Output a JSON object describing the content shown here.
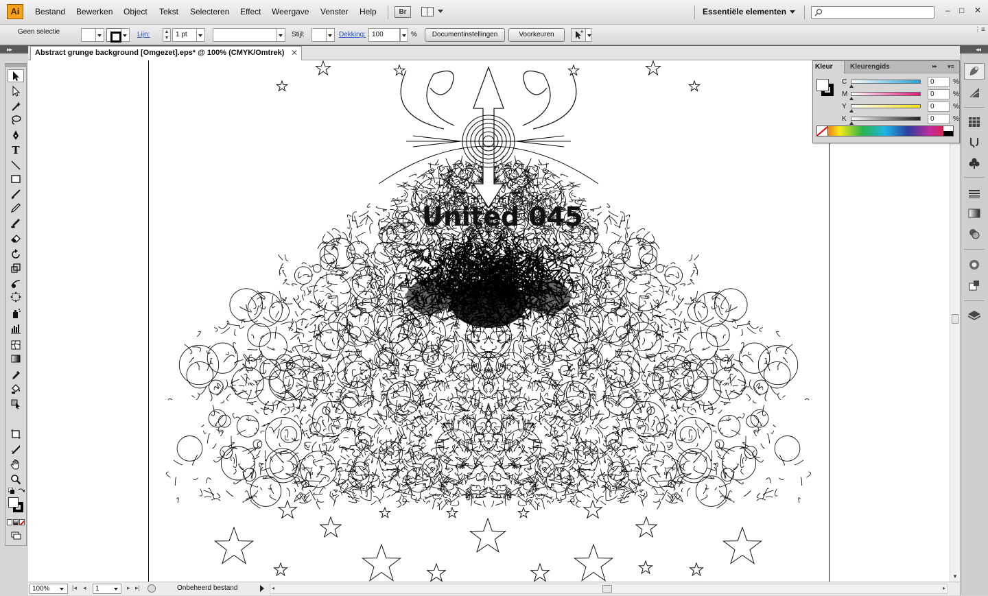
{
  "app": {
    "logo": "Ai",
    "bridge_label": "Br",
    "workspace": "Essentiële elementen"
  },
  "menu": [
    "Bestand",
    "Bewerken",
    "Object",
    "Tekst",
    "Selecteren",
    "Effect",
    "Weergave",
    "Venster",
    "Help"
  ],
  "window_controls": {
    "minimize": "–",
    "restore": "□",
    "close": "✕"
  },
  "controlbar": {
    "selection": "Geen selectie",
    "stroke_label": "Lijn:",
    "stroke_weight": "1 pt",
    "style_label": "Stijl:",
    "opacity_label": "Dekking:",
    "opacity_value": "100",
    "opacity_unit": "%",
    "doc_settings_button": "Documentinstellingen",
    "preferences_button": "Voorkeuren"
  },
  "document": {
    "tab_title": "Abstract grunge background [Omgezet].eps* @ 100% (CMYK/Omtrek)",
    "tab_close": "✕",
    "art_text": "United 045"
  },
  "status": {
    "zoom": "100%",
    "page": "1",
    "info": "Onbeheerd bestand"
  },
  "color_panel": {
    "tab_active": "Kleur",
    "tab_other": "Kleurengids",
    "channels": [
      {
        "label": "C",
        "value": "0",
        "unit": "%",
        "color": "#19a5e0"
      },
      {
        "label": "M",
        "value": "0",
        "unit": "%",
        "color": "#e0197d"
      },
      {
        "label": "Y",
        "value": "0",
        "unit": "%",
        "color": "#f2e21a"
      },
      {
        "label": "K",
        "value": "0",
        "unit": "%",
        "color": "#222222"
      }
    ]
  },
  "tools": [
    "selection-tool",
    "direct-selection-tool",
    "magic-wand-tool",
    "lasso-tool",
    "pen-tool",
    "type-tool",
    "line-segment-tool",
    "rectangle-tool",
    "paintbrush-tool",
    "pencil-tool",
    "blob-brush-tool",
    "eraser-tool",
    "rotate-tool",
    "scale-tool",
    "warp-tool",
    "free-transform-tool",
    "symbol-sprayer-tool",
    "column-graph-tool",
    "mesh-tool",
    "gradient-tool",
    "eyedropper-tool",
    "live-paint-bucket-tool",
    "live-paint-selection-tool",
    "artboard-tool",
    "slice-tool",
    "hand-tool",
    "zoom-tool"
  ],
  "dock_icons": [
    "color-icon",
    "color-guide-icon",
    "swatches-icon",
    "brushes-icon",
    "symbols-icon",
    "stroke-icon",
    "gradient-icon",
    "transparency-icon",
    "appearance-icon",
    "graphic-styles-icon",
    "layers-icon"
  ]
}
